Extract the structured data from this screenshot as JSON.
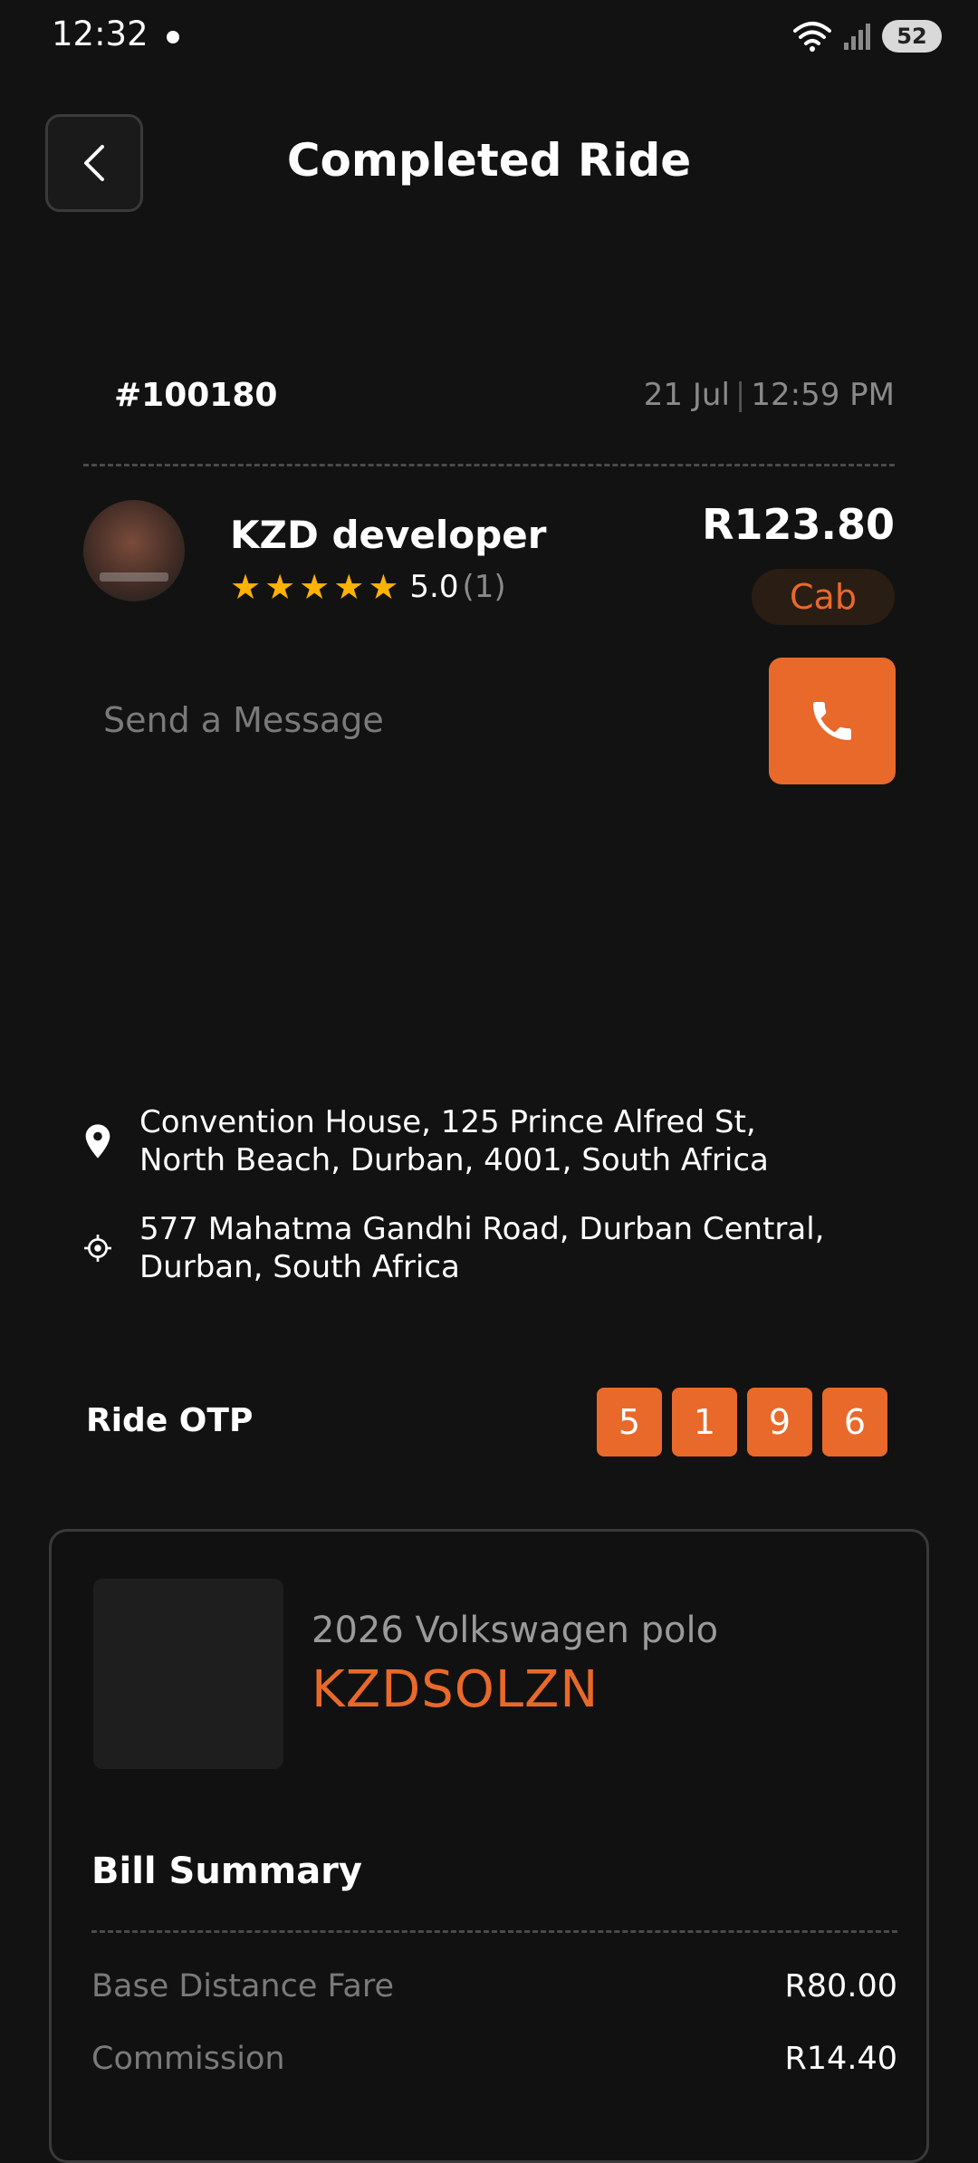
{
  "status_bar": {
    "time": "12:32",
    "battery": "52"
  },
  "header": {
    "title": "Completed Ride"
  },
  "ride": {
    "id": "#100180",
    "date": "21 Jul",
    "time": "12:59 PM"
  },
  "driver": {
    "name": "KZD developer",
    "rating": "5.0",
    "rating_count": "(1)",
    "stars": 5
  },
  "fare": {
    "price": "R123.80",
    "type": "Cab"
  },
  "message": {
    "placeholder": "Send a Message"
  },
  "locations": {
    "pickup": "Convention House, 125 Prince Alfred St, North Beach, Durban, 4001, South Africa",
    "dropoff": "577 Mahatma Gandhi Road, Durban Central, Durban, South Africa"
  },
  "otp": {
    "label": "Ride OTP",
    "digits": [
      "5",
      "1",
      "9",
      "6"
    ]
  },
  "vehicle": {
    "model": "2026 Volkswagen polo",
    "plate": "KZDSOLZN"
  },
  "bill": {
    "title": "Bill Summary",
    "rows": [
      {
        "label": "Base Distance Fare",
        "value": "R80.00"
      },
      {
        "label": "Commission",
        "value": "R14.40"
      }
    ]
  },
  "colors": {
    "accent": "#e8692a",
    "background": "#121212",
    "star": "#ffb300"
  },
  "icons": [
    "wifi-icon",
    "signal-icon",
    "battery-icon",
    "back-arrow-icon",
    "star-icon",
    "phone-icon",
    "location-pin-icon",
    "target-icon"
  ]
}
